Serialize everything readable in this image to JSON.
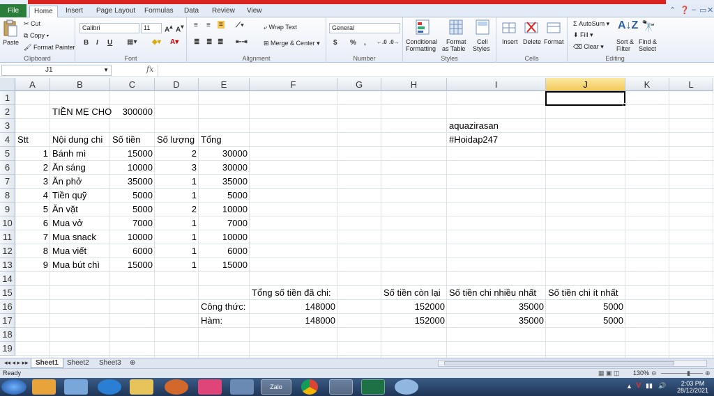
{
  "tabs": {
    "file": "File",
    "items": [
      "Home",
      "Insert",
      "Page Layout",
      "Formulas",
      "Data",
      "Review",
      "View"
    ]
  },
  "ribbon": {
    "clipboard": {
      "paste": "Paste",
      "cut": "Cut",
      "copy": "Copy",
      "format_painter": "Format Painter",
      "label": "Clipboard"
    },
    "font": {
      "name": "Calibri",
      "size": "11",
      "bold": "B",
      "italic": "I",
      "underline": "U",
      "label": "Font"
    },
    "alignment": {
      "wrap": "Wrap Text",
      "merge": "Merge & Center",
      "label": "Alignment"
    },
    "number": {
      "format": "General",
      "currency": "$",
      "percent": "%",
      "comma": ",",
      "label": "Number"
    },
    "styles": {
      "conditional": "Conditional",
      "conditional2": "Formatting",
      "format_table": "Format",
      "format_table2": "as Table",
      "cell_styles": "Cell",
      "cell_styles2": "Styles",
      "label": "Styles"
    },
    "cells": {
      "insert": "Insert",
      "delete": "Delete",
      "format": "Format",
      "label": "Cells"
    },
    "editing": {
      "autosum": "AutoSum",
      "fill": "Fill",
      "clear": "Clear",
      "sort": "Sort &",
      "sort2": "Filter",
      "find": "Find &",
      "find2": "Select",
      "label": "Editing"
    }
  },
  "formula_bar": {
    "name_box": "J1",
    "fx": "fx",
    "value": ""
  },
  "columns": [
    "A",
    "B",
    "C",
    "D",
    "E",
    "F",
    "G",
    "H",
    "I",
    "J",
    "K",
    "L"
  ],
  "selected_column": "J",
  "rows": [
    "1",
    "2",
    "3",
    "4",
    "5",
    "6",
    "7",
    "8",
    "9",
    "10",
    "11",
    "12",
    "13",
    "14",
    "15",
    "16",
    "17",
    "18",
    "19"
  ],
  "cells": {
    "B2": "TIỀN MẸ CHO",
    "C2": "300000",
    "I3": "aquazirasan",
    "I4": "#Hoidap247",
    "A4": "Stt",
    "B4": "Nội dung chi",
    "C4": "Số tiền",
    "D4": "Số lượng",
    "E4": "Tổng",
    "A5": "1",
    "B5": "Bánh mì",
    "C5": "15000",
    "D5": "2",
    "E5": "30000",
    "A6": "2",
    "B6": "Ăn sáng",
    "C6": "10000",
    "D6": "3",
    "E6": "30000",
    "A7": "3",
    "B7": "Ăn phở",
    "C7": "35000",
    "D7": "1",
    "E7": "35000",
    "A8": "4",
    "B8": "Tiền quỹ",
    "C8": "5000",
    "D8": "1",
    "E8": "5000",
    "A9": "5",
    "B9": "Ăn vặt",
    "C9": "5000",
    "D9": "2",
    "E9": "10000",
    "A10": "6",
    "B10": "Mua vở",
    "C10": "7000",
    "D10": "1",
    "E10": "7000",
    "A11": "7",
    "B11": "Mua snack",
    "C11": "10000",
    "D11": "1",
    "E11": "10000",
    "A12": "8",
    "B12": "Mua viết",
    "C12": "6000",
    "D12": "1",
    "E12": "6000",
    "A13": "9",
    "B13": "Mua bút chì",
    "C13": "15000",
    "D13": "1",
    "E13": "15000",
    "F15": "Tổng số tiền đã chi:",
    "H15": "Số tiền còn lại",
    "I15": "Số tiền chi nhiều nhất",
    "J15": "Số tiền chi ít nhất",
    "E16": "Công thức:",
    "F16": "148000",
    "H16": "152000",
    "I16": "35000",
    "J16": "5000",
    "E17": "Hàm:",
    "F17": "148000",
    "H17": "152000",
    "I17": "35000",
    "J17": "5000"
  },
  "sheets": [
    "Sheet1",
    "Sheet2",
    "Sheet3"
  ],
  "active_sheet": "Sheet1",
  "status": {
    "ready": "Ready",
    "zoom": "130%"
  },
  "taskbar": {
    "time": "2:03 PM",
    "date": "28/12/2021"
  }
}
